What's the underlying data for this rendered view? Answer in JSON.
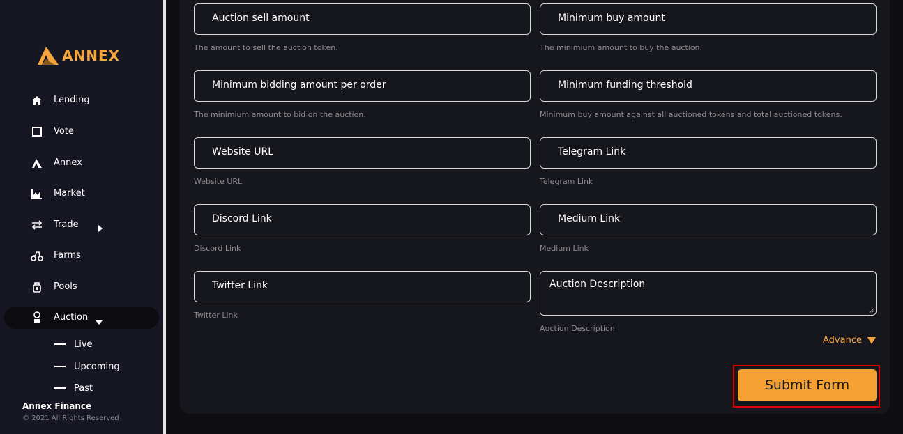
{
  "brand": {
    "logo_text": "ANNEX",
    "accent": "#f5a33b"
  },
  "sidebar": {
    "items": [
      {
        "label": "Lending",
        "icon": "home-icon"
      },
      {
        "label": "Vote",
        "icon": "square-icon"
      },
      {
        "label": "Annex",
        "icon": "annex-logo-icon"
      },
      {
        "label": "Market",
        "icon": "chart-icon"
      },
      {
        "label": "Trade",
        "icon": "swap-icon"
      },
      {
        "label": "Farms",
        "icon": "tractor-icon"
      },
      {
        "label": "Pools",
        "icon": "pool-icon"
      },
      {
        "label": "Auction",
        "icon": "auction-icon"
      }
    ],
    "sub_items": [
      {
        "label": "Live"
      },
      {
        "label": "Upcoming"
      },
      {
        "label": "Past"
      }
    ],
    "footer": {
      "brand": "Annex Finance",
      "copyright": "© 2021 All Rights Reserved"
    }
  },
  "form": {
    "fields": [
      {
        "label": "Auction sell amount",
        "hint": "The amount to sell the auction token."
      },
      {
        "label": "Minimum buy amount",
        "hint": "The minimium amount to buy the auction."
      },
      {
        "label": "Minimum bidding amount per order",
        "hint": "The minimium amount to bid on the auction."
      },
      {
        "label": "Minimum funding threshold",
        "hint": "Minimum buy amount against all auctioned tokens and total auctioned tokens."
      },
      {
        "label": "Website URL",
        "hint": "Website URL"
      },
      {
        "label": "Telegram Link",
        "hint": "Telegram Link"
      },
      {
        "label": "Discord Link",
        "hint": "Discord Link"
      },
      {
        "label": "Medium Link",
        "hint": "Medium Link"
      },
      {
        "label": "Twitter Link",
        "hint": "Twitter Link"
      },
      {
        "label": "Auction Description",
        "hint": "Auction Description"
      }
    ],
    "advance_label": "Advance",
    "submit_label": "Submit Form"
  }
}
